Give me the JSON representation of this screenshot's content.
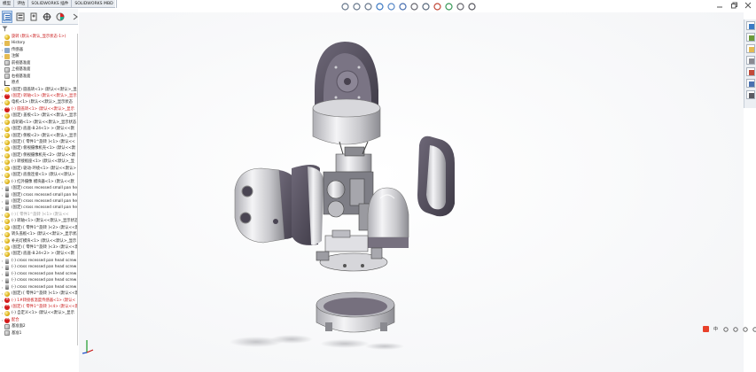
{
  "tabs": [
    "模型",
    "评估",
    "SOLIDWORKS 插件",
    "SOLIDWORKS MBD"
  ],
  "fm_toolbar": {
    "icons": [
      "feature-manager-icon",
      "property-manager-icon",
      "configuration-manager-icon",
      "dimxpert-icon",
      "display-manager-icon"
    ],
    "filter_icon": "filter-icon"
  },
  "tree": [
    {
      "label": "旋转 (默认<默认_显示状态-1>)",
      "icon": "part",
      "color": "red",
      "exp": ""
    },
    {
      "label": "History",
      "icon": "folder",
      "color": "",
      "exp": "›"
    },
    {
      "label": "传感器",
      "icon": "sensor",
      "color": "",
      "exp": "›"
    },
    {
      "label": "注解",
      "icon": "folder",
      "color": "",
      "exp": "›"
    },
    {
      "label": "前视基准面",
      "icon": "plane",
      "color": "",
      "exp": ""
    },
    {
      "label": "上视基准面",
      "icon": "plane",
      "color": "",
      "exp": ""
    },
    {
      "label": "右视基准面",
      "icon": "plane",
      "color": "",
      "exp": ""
    },
    {
      "label": "原点",
      "icon": "origin",
      "color": "",
      "exp": ""
    },
    {
      "label": "(固定) 圆盖转<1> (默认<<默认>_显示",
      "icon": "part",
      "color": "",
      "exp": "›"
    },
    {
      "label": "(固定) 转轴<1> (默认<<默认>_显示",
      "icon": "err",
      "color": "red",
      "exp": "›"
    },
    {
      "label": "电机<1> (默认<<默认>_显示状态",
      "icon": "part",
      "color": "",
      "exp": "›"
    },
    {
      "label": "(-) 圆盖转<1> (默认<<默认>_显示",
      "icon": "err",
      "color": "red",
      "exp": "›"
    },
    {
      "label": "(固定) 盖板<1> (默认<<默认>_显示",
      "icon": "part",
      "color": "",
      "exp": "›"
    },
    {
      "label": "齿轮箱<1> (默认<<默认>_显示状态",
      "icon": "part",
      "color": "",
      "exp": "›"
    },
    {
      "label": "(固定) 底座-8.24<1> > (默认<<默",
      "icon": "part",
      "color": "",
      "exp": "›"
    },
    {
      "label": "(固定) 侧板<2> (默认<<默认>_显示",
      "icon": "part",
      "color": "",
      "exp": "›"
    },
    {
      "label": "(固定) [ 零件1^旋转 ]<1> (默认<<",
      "icon": "part",
      "color": "",
      "exp": "›"
    },
    {
      "label": "(固定) 俯视摄像机壳<1> (默认<<默",
      "icon": "part",
      "color": "",
      "exp": "›"
    },
    {
      "label": "(固定) 侧视摄像机壳<2> (默认<<默",
      "icon": "part",
      "color": "",
      "exp": "›"
    },
    {
      "label": "(-) 转接板座<1> (默认<<默认>_显",
      "icon": "part",
      "color": "",
      "exp": "›"
    },
    {
      "label": "(固定) 驱动-环绕<1> (默认<<默认>",
      "icon": "part",
      "color": "",
      "exp": "›"
    },
    {
      "label": "(固定) 底盘连接<1> (默认<<默认>",
      "icon": "part",
      "color": "",
      "exp": "›"
    },
    {
      "label": "(-) 红外摄像 模块器<1> (默认<<默",
      "icon": "part",
      "color": "",
      "exp": "›"
    },
    {
      "label": "(固定) cross recessed small pan he",
      "icon": "screw",
      "color": "",
      "exp": "›"
    },
    {
      "label": "(固定) cross recessed small pan he",
      "icon": "screw",
      "color": "",
      "exp": "›"
    },
    {
      "label": "(固定) cross recessed small pan he",
      "icon": "screw",
      "color": "",
      "exp": "›"
    },
    {
      "label": "(固定) cross recessed small pan he",
      "icon": "screw",
      "color": "",
      "exp": "›"
    },
    {
      "label": "(-) [ 零件1^旋转 ]<1> (默认<<",
      "icon": "part",
      "color": "gray",
      "exp": "›"
    },
    {
      "label": "(-) 转轴<1> (默认<<默认>_显示状态",
      "icon": "part",
      "color": "",
      "exp": "›"
    },
    {
      "label": "(固定) [ 零件1^旋转 ]<2> (默认<<默",
      "icon": "part",
      "color": "",
      "exp": "›"
    },
    {
      "label": "转头盖板<1> (默认<<默认>_显示状态",
      "icon": "part",
      "color": "",
      "exp": "›"
    },
    {
      "label": "补光灯模块<1> (默认<<默认>_显示",
      "icon": "part",
      "color": "",
      "exp": "›"
    },
    {
      "label": "(固定) [ 零件1^旋转 ]<3> (默认<<默",
      "icon": "part",
      "color": "",
      "exp": "›"
    },
    {
      "label": "(固定) 底座-8.24<2> > (默认<<默",
      "icon": "part",
      "color": "",
      "exp": "›"
    },
    {
      "label": "(-) cross recessed pan head screw",
      "icon": "screw",
      "color": "",
      "exp": "›"
    },
    {
      "label": "(-) cross recessed pan head screw",
      "icon": "screw",
      "color": "",
      "exp": "›"
    },
    {
      "label": "(-) cross recessed pan head screw",
      "icon": "screw",
      "color": "",
      "exp": "›"
    },
    {
      "label": "(-) cross recessed pan head screw",
      "icon": "screw",
      "color": "",
      "exp": "›"
    },
    {
      "label": "(-) cross recessed pan head screw",
      "icon": "screw",
      "color": "",
      "exp": "›"
    },
    {
      "label": "(固定) [ 零件2^旋转 ]<1> (默认<<默",
      "icon": "part",
      "color": "",
      "exp": "›"
    },
    {
      "label": "(-) 1#转接板温度传感器<1> (默认<",
      "icon": "err",
      "color": "red",
      "exp": "›"
    },
    {
      "label": "(固定) [ 零件1^旋转 ]<4> (默认<<默",
      "icon": "err",
      "color": "red",
      "exp": "›"
    },
    {
      "label": "(-) 自定义<1> (默认<<默认>_显示",
      "icon": "part",
      "color": "",
      "exp": "›"
    },
    {
      "label": "配合",
      "icon": "err",
      "color": "red",
      "exp": "›"
    },
    {
      "label": "基准面2",
      "icon": "plane",
      "color": "",
      "exp": ""
    },
    {
      "label": "基准1",
      "icon": "plane",
      "color": "",
      "exp": ""
    }
  ],
  "view_toolbar": [
    "zoom-to-fit-icon",
    "zoom-area-icon",
    "previous-view-icon",
    "section-view-icon",
    "dynamic-annotation-icon",
    "view-orientation-icon",
    "display-style-icon",
    "hide-show-items-icon",
    "edit-appearance-icon",
    "apply-scene-icon",
    "view-settings-icon",
    "monitor-icon"
  ],
  "window_controls": [
    "minimize-icon",
    "restore-icon",
    "close-icon"
  ],
  "task_pane": [
    "solidworks-resources-icon",
    "design-library-icon",
    "file-explorer-icon",
    "view-palette-icon",
    "appearances-icon",
    "custom-properties-icon",
    "forum-icon"
  ],
  "ime_bar": {
    "icons": [
      "ime-s-icon",
      "ime-chinese-icon",
      "ime-punctuation-icon",
      "ime-mic-icon",
      "ime-keyboard-icon",
      "ime-settings-icon",
      "ime-skin-icon",
      "ime-menu-icon"
    ],
    "label": "中"
  },
  "colors": {
    "accent": "#d31b1b",
    "model_metal": "#d9d9dc",
    "model_shadow": "#4a4553",
    "selected": "#dce9f8"
  }
}
